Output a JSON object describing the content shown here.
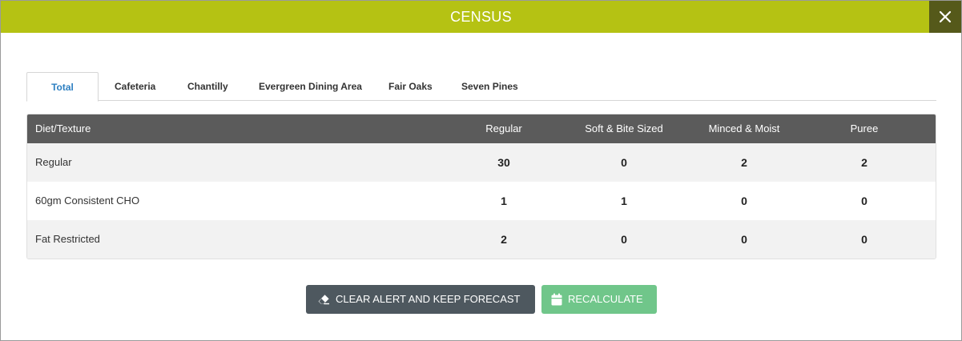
{
  "window": {
    "title": "CENSUS",
    "close_icon": "close-icon"
  },
  "tabs": [
    {
      "label": "Total",
      "active": true
    },
    {
      "label": "Cafeteria",
      "active": false
    },
    {
      "label": "Chantilly",
      "active": false
    },
    {
      "label": "Evergreen Dining Area",
      "active": false
    },
    {
      "label": "Fair Oaks",
      "active": false
    },
    {
      "label": "Seven Pines",
      "active": false
    }
  ],
  "table": {
    "headers": [
      "Diet/Texture",
      "Regular",
      "Soft & Bite Sized",
      "Minced & Moist",
      "Puree"
    ],
    "rows": [
      {
        "diet": "Regular",
        "values": [
          "30",
          "0",
          "2",
          "2"
        ]
      },
      {
        "diet": "60gm Consistent CHO",
        "values": [
          "1",
          "1",
          "0",
          "0"
        ]
      },
      {
        "diet": "Fat Restricted",
        "values": [
          "2",
          "0",
          "0",
          "0"
        ]
      }
    ]
  },
  "buttons": {
    "clear": {
      "label": "CLEAR ALERT AND KEEP FORECAST",
      "icon": "eraser-icon"
    },
    "recalculate": {
      "label": "RECALCULATE",
      "icon": "calendar-icon"
    }
  },
  "colors": {
    "header_bg": "#b5c213",
    "close_bg": "#55591a",
    "table_header_bg": "#5b5b5b",
    "active_tab_text": "#2d7fc1",
    "clear_button_bg": "#4e585f",
    "recalculate_button_bg": "#70c68a"
  }
}
